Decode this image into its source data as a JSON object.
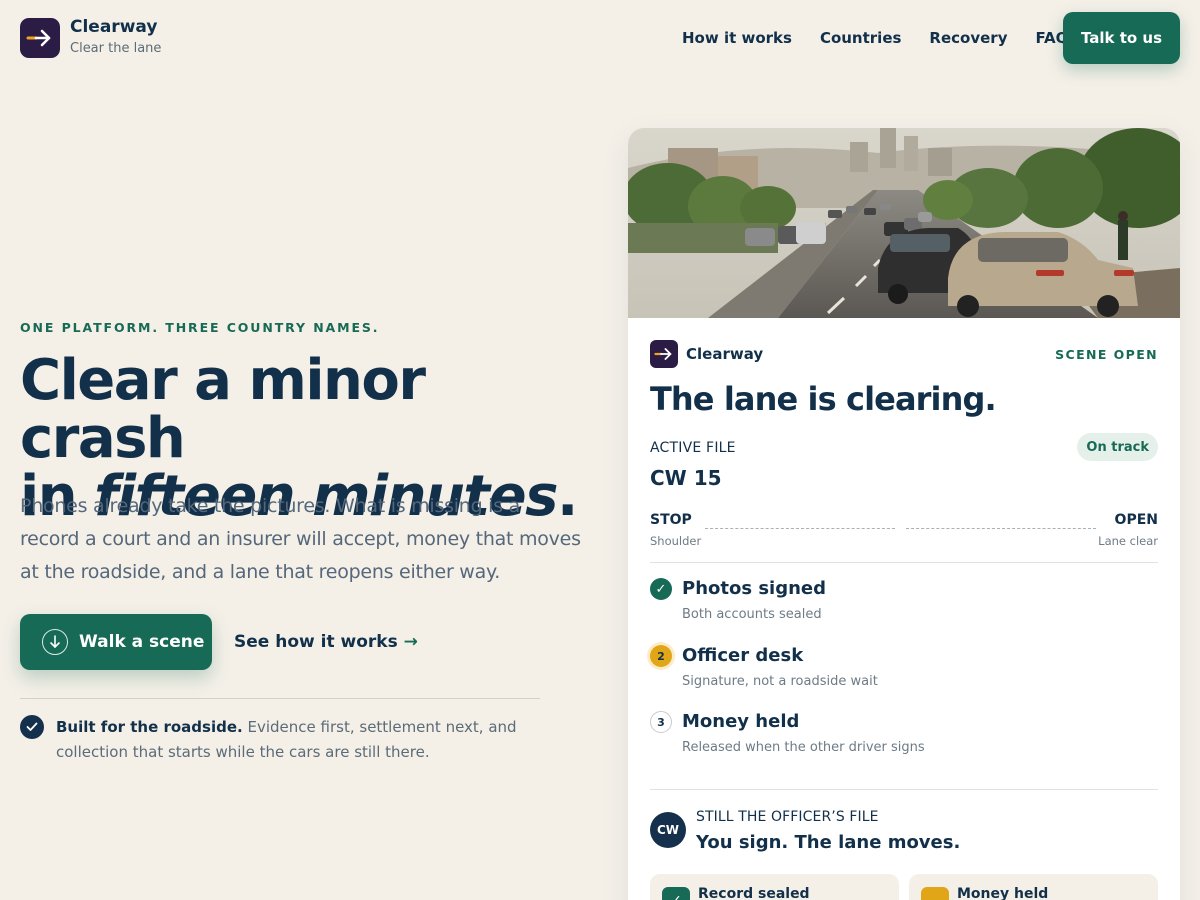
{
  "brand": {
    "name": "Clearway",
    "tagline": "Clear the lane"
  },
  "nav": {
    "items": [
      {
        "label": "How it works"
      },
      {
        "label": "Countries"
      },
      {
        "label": "Recovery"
      },
      {
        "label": "FAQ"
      }
    ],
    "cta_label": "Talk to us"
  },
  "hero": {
    "eyebrow": "ONE PLATFORM. THREE COUNTRY NAMES.",
    "headline_line1": "Clear a minor crash",
    "headline_in": "in ",
    "headline_emphasis": "fifteen minutes",
    "headline_period": ".",
    "lede": "Phones already take the pictures. What is missing is a record a court and an insurer will accept, money that moves at the roadside, and a lane that reopens either way.",
    "primary_cta": "Walk a scene",
    "secondary_cta": "See how it works",
    "secondary_arrow": "→",
    "roadside_bold": "Built for the roadside.",
    "roadside_text": " Evidence first, settlement next, and collection that starts while the cars are still there."
  },
  "card": {
    "brand_name": "Clearway",
    "status": "SCENE OPEN",
    "title": "The lane is clearing.",
    "active_file_label": "ACTIVE FILE",
    "status_pill": "On track",
    "file_id": "CW 15",
    "route": {
      "start": "STOP",
      "start_sub": "Shoulder",
      "end": "OPEN",
      "end_sub": "Lane clear"
    },
    "steps": [
      {
        "badge": "✓",
        "title": "Photos signed",
        "sub": "Both accounts sealed",
        "state": "done"
      },
      {
        "badge": "2",
        "title": "Officer desk",
        "sub": "Signature, not a roadside wait",
        "state": "active"
      },
      {
        "badge": "3",
        "title": "Money held",
        "sub": "Released when the other driver signs",
        "state": "todo"
      }
    ],
    "officer": {
      "initials": "CW",
      "label": "STILL THE OFFICER’S FILE",
      "title": "You sign. The lane moves."
    },
    "mini_cards": [
      {
        "label": "Record sealed",
        "icon": "✓",
        "color": "#176a55"
      },
      {
        "label": "Money held",
        "icon": "",
        "color": "#e1a617"
      }
    ]
  },
  "colors": {
    "background": "#f4f0e8",
    "brand_green": "#176a55",
    "navy": "#12304a",
    "logo_purple": "#2a1c45",
    "amber": "#e1a617"
  },
  "icons": {
    "logo": "arrow-right-icon",
    "walk": "arrow-down-circle-icon",
    "check": "check-icon"
  }
}
